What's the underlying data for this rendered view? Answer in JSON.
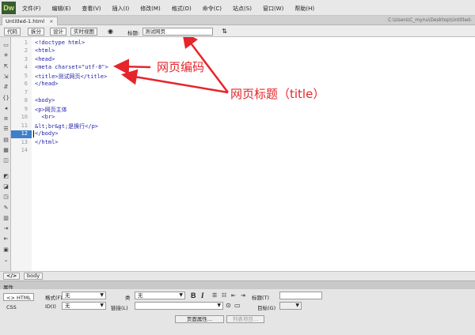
{
  "app": {
    "logo": "Dw"
  },
  "menu": [
    "文件(F)",
    "编辑(E)",
    "查看(V)",
    "插入(I)",
    "修改(M)",
    "格式(O)",
    "命令(C)",
    "站点(S)",
    "窗口(W)",
    "帮助(H)"
  ],
  "file_tab": {
    "name": "Untitled-1.html",
    "close": "×",
    "path": "C:\\Users\\C_mynu\\Desktop\\Untitled-"
  },
  "toolbar": {
    "code": "代码",
    "split": "拆分",
    "design": "设计",
    "live": "实时视图",
    "title_label": "标题:",
    "title_value": "测试网页"
  },
  "editor": {
    "lines": [
      "<!doctype html>",
      "<html>",
      "<head>",
      "<meta charset=\"utf-8\">",
      "<title>测试网页</title>",
      "</head>",
      "",
      "<body>",
      "<p>网页主体",
      "  <br>",
      "&lt;br&gt;是换行</p>",
      "</body>",
      "</html>",
      ""
    ],
    "current_line": 12
  },
  "annotations": {
    "encoding": "网页编码",
    "title": "网页标题（title）"
  },
  "tag_selector": {
    "code_btn": "</>",
    "body": "body"
  },
  "properties": {
    "header": "属性",
    "html_tab": "<> HTML",
    "css_tab": "CSS",
    "format_label": "格式(F)",
    "format_value": "无",
    "class_label": "类",
    "class_value": "无",
    "id_label": "ID(I)",
    "id_value": "无",
    "link_label": "链接(L)",
    "title_label": "标题(T)",
    "target_label": "目标(G)",
    "bold": "B",
    "italic": "I",
    "page_props_btn": "页面属性...",
    "list_item_btn": "列表项目..."
  }
}
